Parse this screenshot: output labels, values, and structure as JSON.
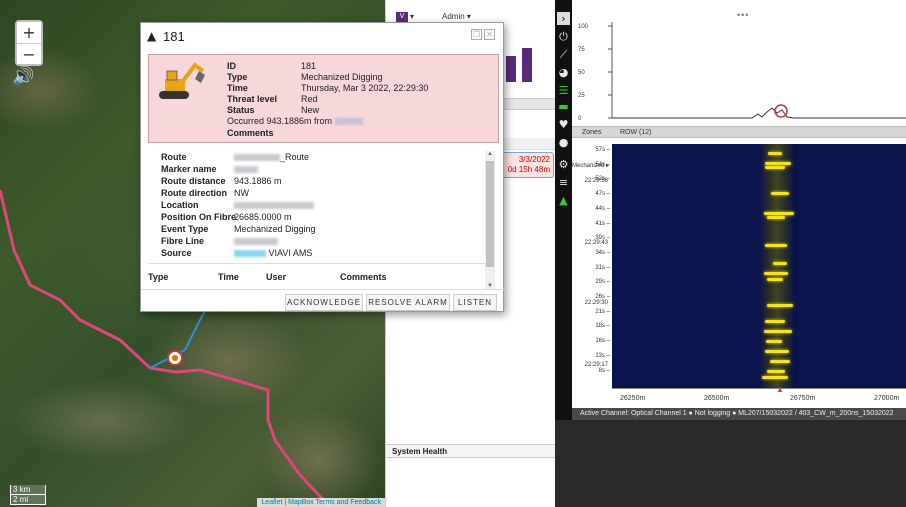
{
  "map": {
    "zoom_in": "+",
    "zoom_out": "−",
    "scale_top": "3 km",
    "scale_bottom": "2 mi",
    "attribution": "Leaflet | MapBox Terms and Feedback"
  },
  "header": {
    "user_menu": "Admin ▾",
    "v_logo": "V",
    "v_caret": "▾"
  },
  "alarm_list": {
    "entry_date": "3/3/2022",
    "entry_age": "0d 15h 48m"
  },
  "system_health": "System Health",
  "dialog": {
    "title": "181",
    "summary": {
      "id_label": "ID",
      "id_value": "181",
      "type_label": "Type",
      "type_value": "Mechanized Digging",
      "time_label": "Time",
      "time_value": "Thursday, Mar 3 2022, 22:29:30",
      "threat_label": "Threat level",
      "threat_value": "Red",
      "status_label": "Status",
      "status_value": "New",
      "occurred_prefix": "Occurred 943.1886m from",
      "comments_label": "Comments"
    },
    "details": {
      "route_label": "Route",
      "route_suffix": "_Route",
      "marker_label": "Marker name",
      "route_distance_label": "Route distance",
      "route_distance_value": "943.1886 m",
      "route_direction_label": "Route direction",
      "route_direction_value": "NW",
      "location_label": "Location",
      "position_label": "Position On Fibre",
      "position_value": "26685.0000 m",
      "event_type_label": "Event Type",
      "event_type_value": "Mechanized Digging",
      "fibre_line_label": "Fibre Line",
      "source_label": "Source",
      "source_value": "VIAVI AMS"
    },
    "events_table": {
      "col_type": "Type",
      "col_time": "Time",
      "col_user": "User",
      "col_comments": "Comments"
    },
    "buttons": {
      "acknowledge": "ACKNOWLEDGE",
      "resolve": "RESOLVE ALARM",
      "listen": "LISTEN"
    }
  },
  "trace": {
    "y_ticks": [
      "100",
      "75",
      "50",
      "25",
      "0"
    ],
    "zones_label": "Zones",
    "row_label": "ROW (12)"
  },
  "waterfall": {
    "y_ticks": [
      "57s",
      "54s",
      "52s",
      "47s",
      "44s",
      "41s",
      "39s",
      "34s",
      "31s",
      "29s",
      "26s",
      "21s",
      "18s",
      "16s",
      "13s",
      "8s"
    ],
    "time_labels": [
      "22:29:56",
      "22:29:43",
      "22:29:30",
      "22:29:17"
    ],
    "mechanized_label": "Mechanized",
    "x_ticks": [
      "26250m",
      "26500m",
      "26750m",
      "27000m"
    ]
  },
  "status_bar": "Active Channel: Optical Channel 1   ● Not logging ● ML207/15032022 / 403_CW_m_200ns_15032022",
  "colors": {
    "alarm_red": "#c00000",
    "brand_purple": "#5b2b7a",
    "route_pink": "#e0457b",
    "heat_yellow": "#f4e21b"
  }
}
